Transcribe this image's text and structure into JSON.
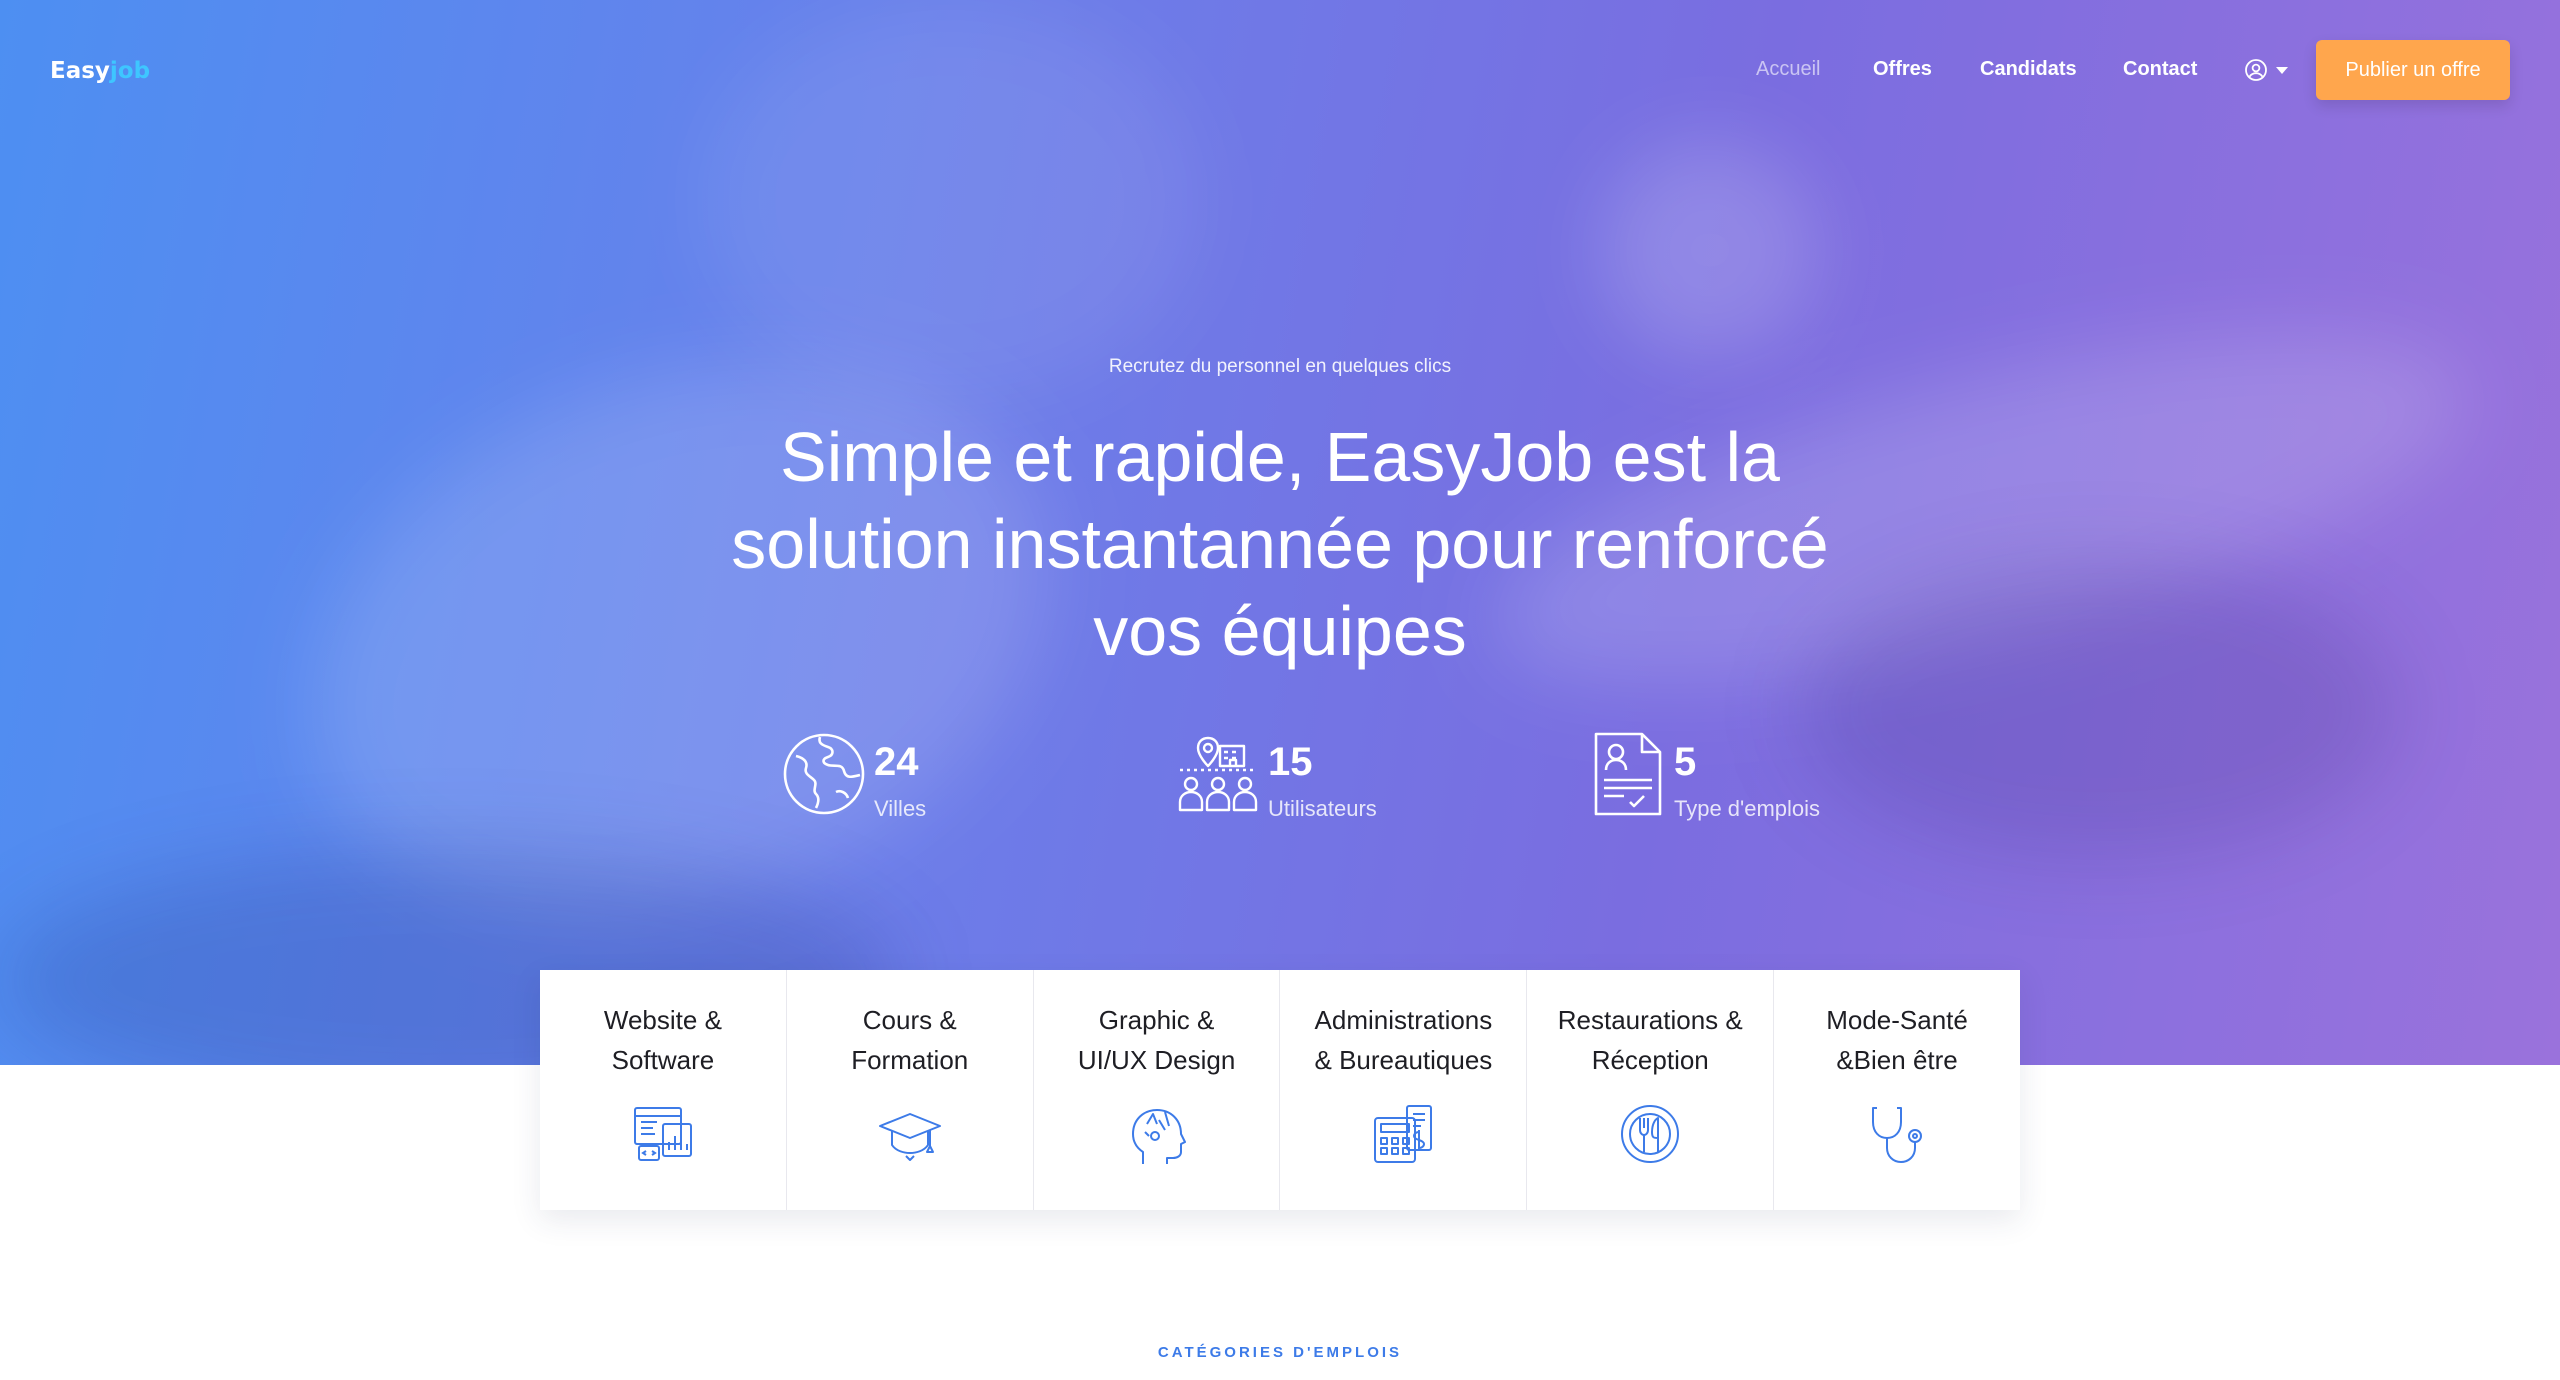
{
  "brand": {
    "logo_prefix": "Easy",
    "logo_accent": "job"
  },
  "nav": {
    "links": [
      "Accueil",
      "Offres",
      "Candidats",
      "Contact"
    ],
    "active": "Accueil",
    "user_icon": "user-circle-icon",
    "cta_label": "Publier un offre"
  },
  "hero": {
    "eyebrow": "Recrutez du personnel en quelques clics",
    "headline_lines": [
      "Simple et rapide, EasyJob est la",
      "solution instantannée pour renforcé",
      "vos équipes"
    ]
  },
  "stats": [
    {
      "icon": "globe-icon",
      "value": "24",
      "label": "Villes"
    },
    {
      "icon": "users-location-icon",
      "value": "15",
      "label": "Utilisateurs"
    },
    {
      "icon": "document-icon",
      "value": "5",
      "label": "Type d'emplois"
    }
  ],
  "categories": [
    {
      "line1": "Website &",
      "line2": "Software",
      "icon": "website-software-icon"
    },
    {
      "line1": "Cours &",
      "line2": "Formation",
      "icon": "graduation-cap-icon"
    },
    {
      "line1": "Graphic &",
      "line2": "UI/UX Design",
      "icon": "creative-head-icon"
    },
    {
      "line1": "Administrations",
      "line2": "& Bureautiques",
      "icon": "calculator-icon"
    },
    {
      "line1": "Restaurations &",
      "line2": "Réception",
      "icon": "plate-cutlery-icon"
    },
    {
      "line1": "Mode-Santé",
      "line2": "&Bien être",
      "icon": "stethoscope-icon"
    }
  ],
  "section": {
    "label": "CATÉGORIES D'EMPLOIS"
  },
  "colors": {
    "accent_blue": "#3d7be8",
    "cta_orange": "#ffa64d",
    "logo_accent": "#3ec6ff"
  }
}
